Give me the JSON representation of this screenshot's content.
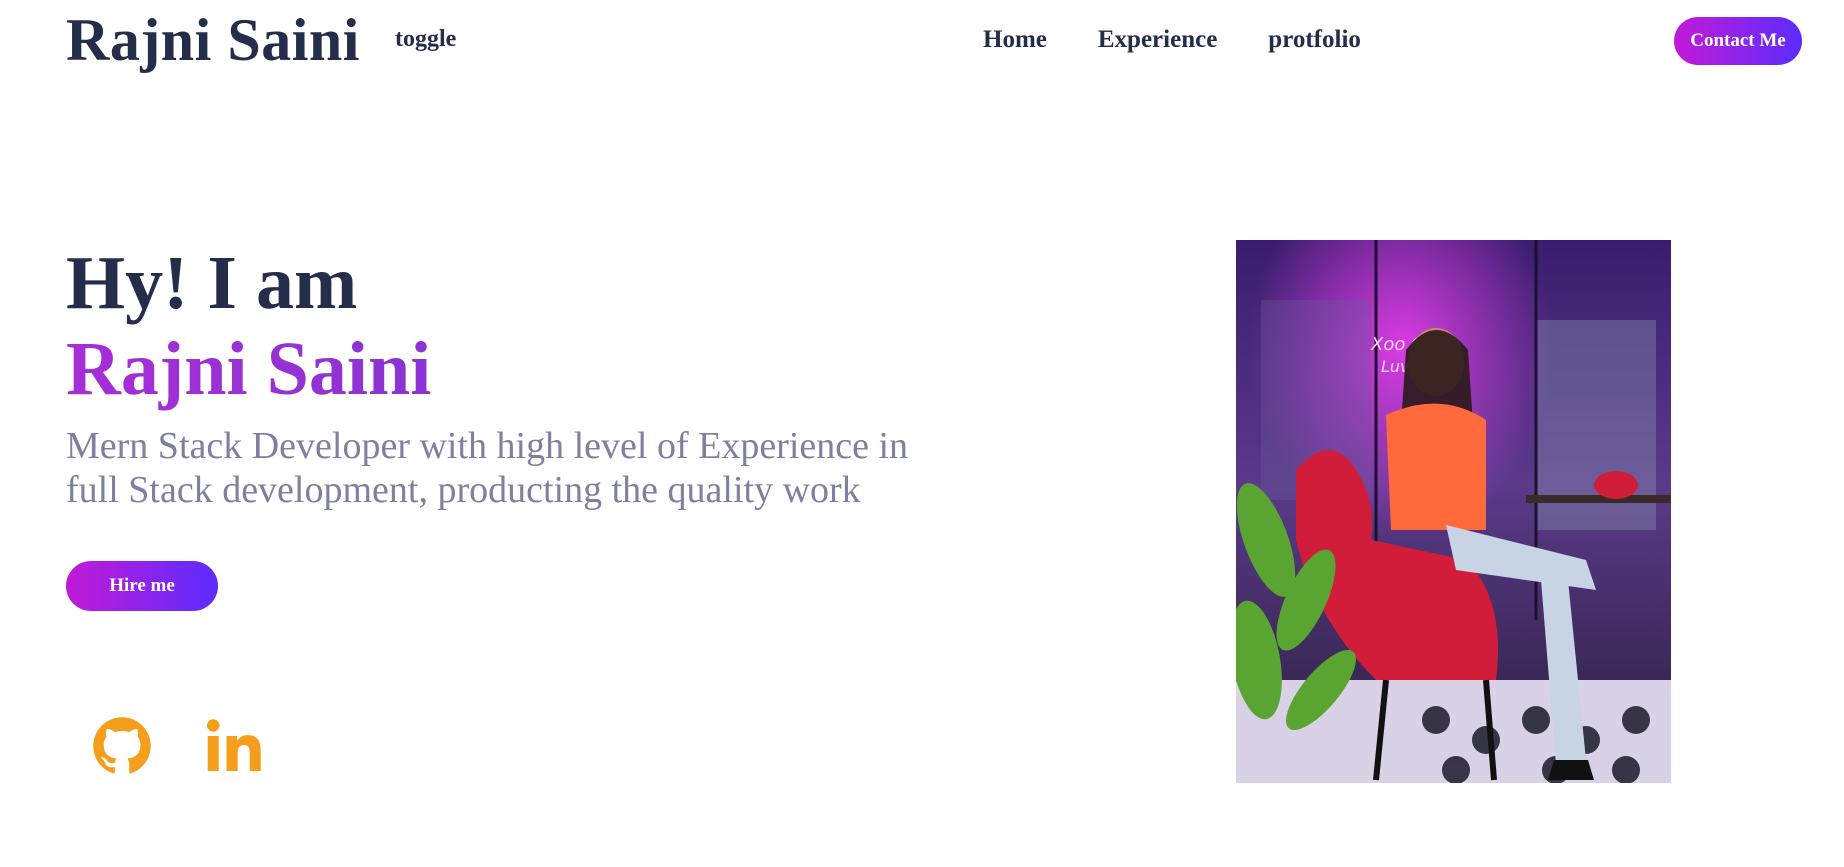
{
  "nav": {
    "brand": "Rajni Saini",
    "toggle": "toggle",
    "links": [
      "Home",
      "Experience",
      "protfolio"
    ],
    "contact": "Contact Me"
  },
  "hero": {
    "greeting": "Hy! I am",
    "name": "Rajni Saini",
    "description": "Mern Stack Developer with high level of Experience in full Stack development, producting the quality work",
    "hire": "Hire me"
  },
  "social": {
    "icons": [
      "github-icon",
      "linkedin-icon"
    ],
    "color": "#f59e1b"
  },
  "colors": {
    "text_dark": "#242d4a",
    "accent_start": "#c21ad6",
    "accent_end": "#5b2cff",
    "name": "#9b31d4",
    "muted": "#7d80a0"
  }
}
